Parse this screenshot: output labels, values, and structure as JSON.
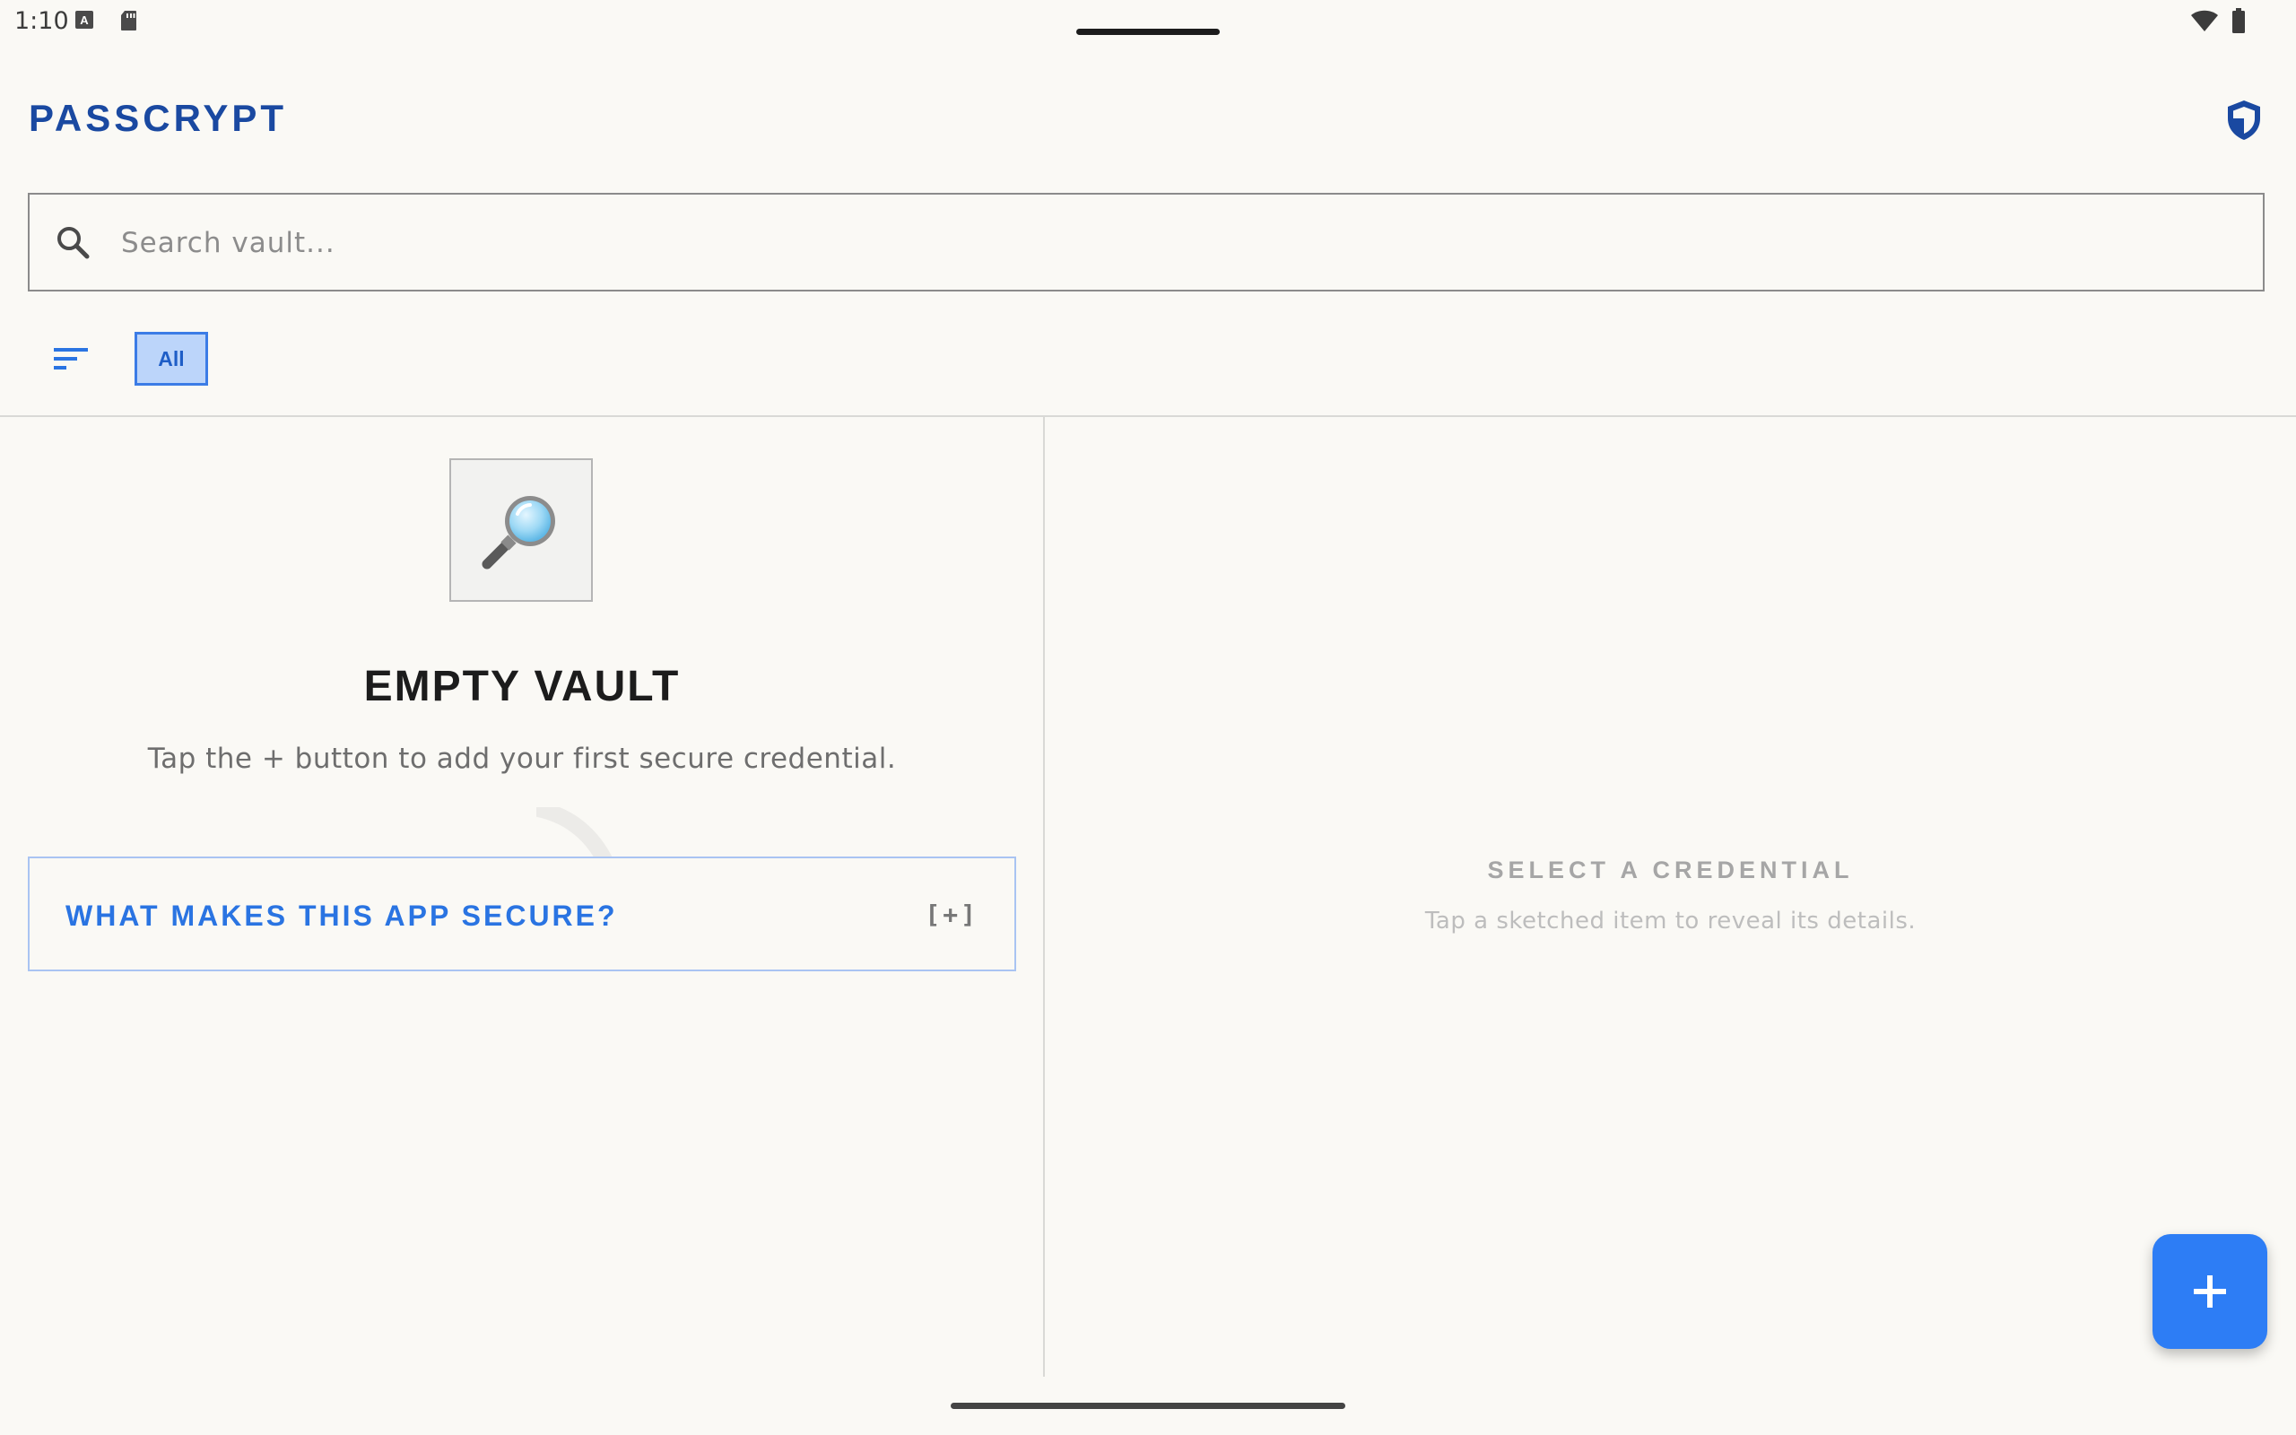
{
  "status_bar": {
    "time": "1:10",
    "notification_icons": [
      "keyboard-a-icon",
      "sd-card-icon"
    ],
    "system_icons": [
      "wifi-icon",
      "battery-icon"
    ]
  },
  "header": {
    "title": "PASSCRYPT",
    "security_icon": "shield-icon"
  },
  "search": {
    "placeholder": "Search vault...",
    "value": ""
  },
  "filters": {
    "sort_icon": "sort-icon",
    "chips": [
      {
        "label": "All",
        "selected": true
      }
    ]
  },
  "empty_state": {
    "illustration_icon": "magnifying-glass-icon",
    "title": "EMPTY VAULT",
    "subtitle": "Tap the + button to add your first secure credential."
  },
  "security_info": {
    "label": "WHAT MAKES THIS APP SECURE?",
    "toggle": "[+]",
    "expanded": false
  },
  "detail_pane": {
    "title": "SELECT A CREDENTIAL",
    "subtitle": "Tap a sketched item to reveal its details."
  },
  "fab": {
    "icon": "plus-icon"
  },
  "colors": {
    "background": "#faf9f5",
    "brand": "#1a49a1",
    "accent": "#2d7df5",
    "chip_fill": "#bcd5fa",
    "expander_border": "#a9c4f2"
  }
}
